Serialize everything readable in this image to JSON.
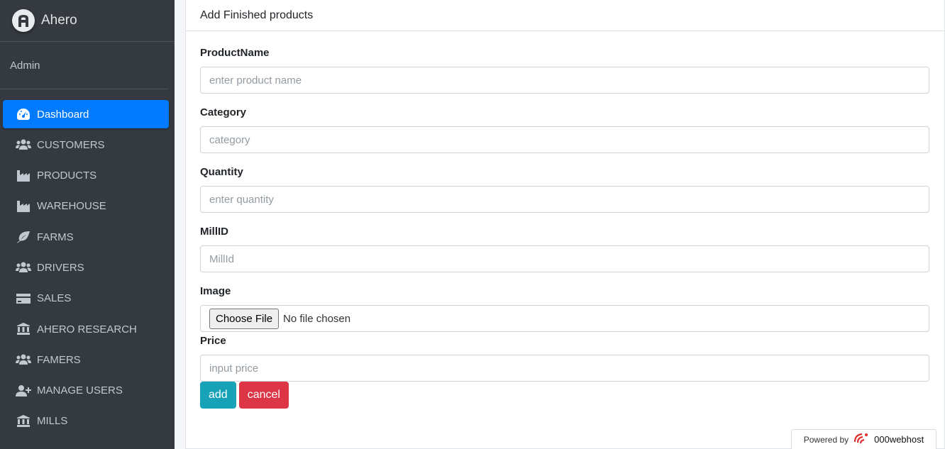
{
  "brand": {
    "name": "Ahero"
  },
  "user": {
    "name": "Admin"
  },
  "sidebar": {
    "items": [
      {
        "label": "Dashboard",
        "icon": "dashboard-icon"
      },
      {
        "label": "CUSTOMERS",
        "icon": "users-icon"
      },
      {
        "label": "PRODUCTS",
        "icon": "factory-icon"
      },
      {
        "label": "WAREHOUSE",
        "icon": "factory-icon"
      },
      {
        "label": "FARMS",
        "icon": "leaf-icon"
      },
      {
        "label": "DRIVERS",
        "icon": "users-icon"
      },
      {
        "label": "SALES",
        "icon": "credit-card-icon"
      },
      {
        "label": "AHERO RESEARCH",
        "icon": "bank-icon"
      },
      {
        "label": "FAMERS",
        "icon": "users-icon"
      },
      {
        "label": "MANAGE USERS",
        "icon": "user-plus-icon"
      },
      {
        "label": "MILLS",
        "icon": "bank-icon"
      }
    ],
    "active_index": 0
  },
  "form": {
    "title": "Add Finished products",
    "fields": {
      "product_name": {
        "label": "ProductName",
        "placeholder": "enter product name",
        "value": ""
      },
      "category": {
        "label": "Category",
        "placeholder": "category",
        "value": ""
      },
      "quantity": {
        "label": "Quantity",
        "placeholder": "enter quantity",
        "value": ""
      },
      "mill_id": {
        "label": "MillID",
        "placeholder": "MillId",
        "value": ""
      },
      "image": {
        "label": "Image",
        "button": "Choose File",
        "status": "No file chosen"
      },
      "price": {
        "label": "Price",
        "placeholder": "input price",
        "value": ""
      }
    },
    "add_label": "add",
    "cancel_label": "cancel"
  },
  "powered_by": {
    "prefix": "Powered by",
    "host": "000webhost"
  },
  "colors": {
    "sidebar_bg": "#343a40",
    "active": "#007bff",
    "add": "#17a2b8",
    "cancel": "#dc3545"
  }
}
